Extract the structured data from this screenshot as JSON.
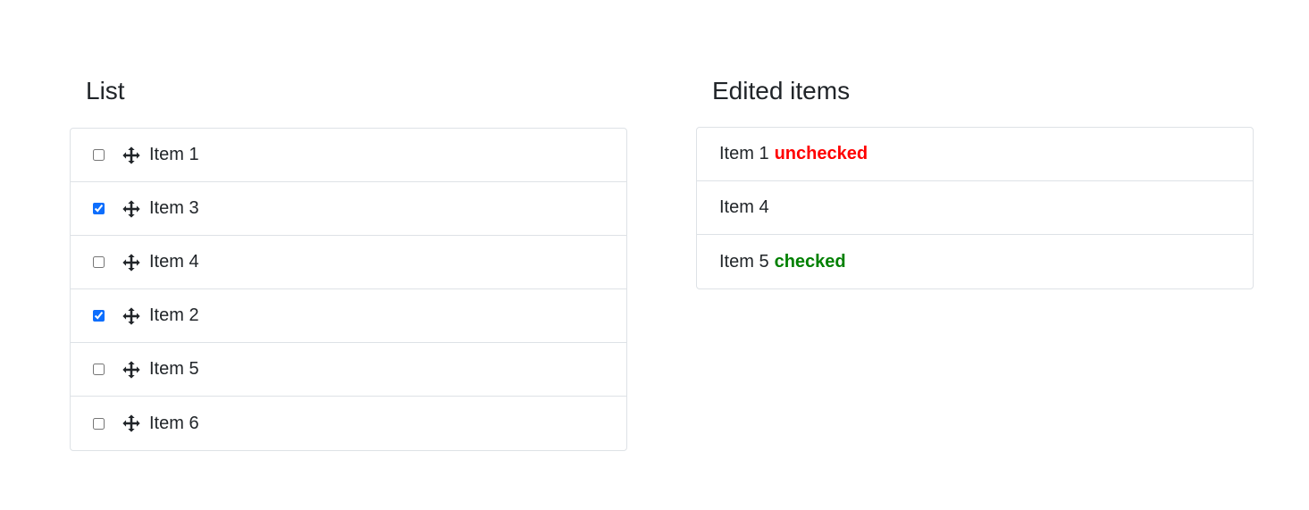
{
  "list": {
    "title": "List",
    "items": [
      {
        "label": "Item 1",
        "checked": false
      },
      {
        "label": "Item 3",
        "checked": true
      },
      {
        "label": "Item 4",
        "checked": false
      },
      {
        "label": "Item 2",
        "checked": true
      },
      {
        "label": "Item 5",
        "checked": false
      },
      {
        "label": "Item 6",
        "checked": false
      }
    ]
  },
  "edited": {
    "title": "Edited items",
    "items": [
      {
        "label": "Item 1",
        "status": "unchecked",
        "status_color": "#ff0000"
      },
      {
        "label": "Item 4",
        "status": "",
        "status_color": ""
      },
      {
        "label": "Item 5",
        "status": "checked",
        "status_color": "#008000"
      }
    ]
  },
  "icons": {
    "drag_handle": "move-icon"
  },
  "colors": {
    "checkbox_accent": "#0d6efd",
    "border": "#dee2e6",
    "text": "#212529"
  }
}
